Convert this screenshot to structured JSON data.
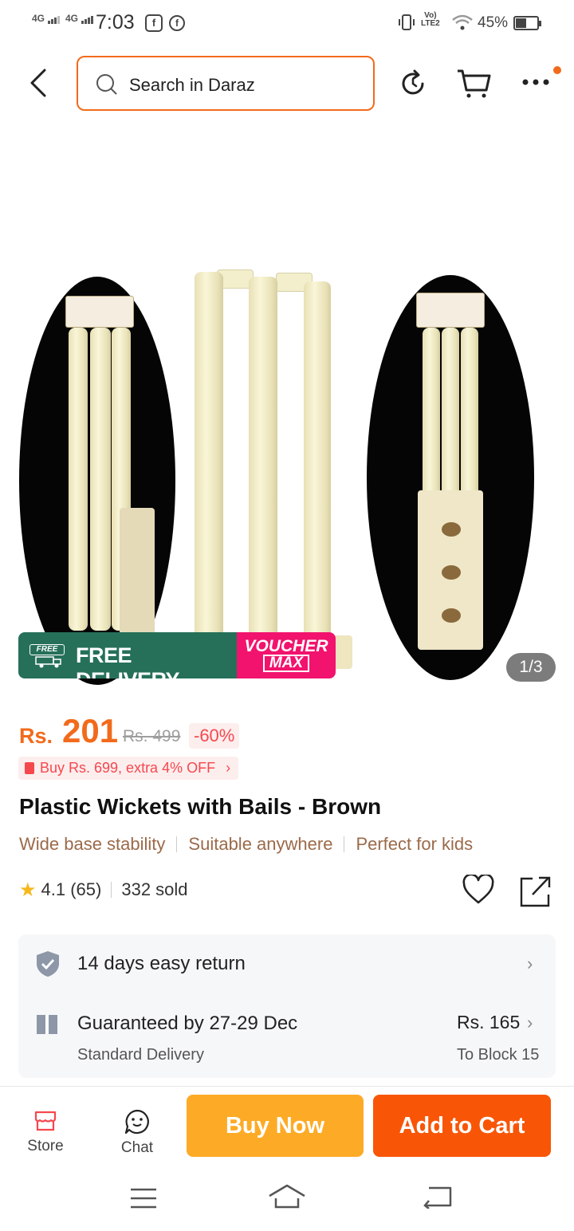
{
  "status_bar": {
    "sim1": "4G",
    "sim2": "4G",
    "time": "7:03",
    "facebook_icon": "facebook-icon",
    "volte": "Vo) LTE2",
    "battery_pct": "45%"
  },
  "header": {
    "search_placeholder": "Search in Daraz",
    "icons": [
      "back-arrow-icon",
      "history-icon",
      "cart-icon",
      "more-icon"
    ]
  },
  "gallery": {
    "image_desc_icon": "cricket-wickets-image",
    "counter": "1/3",
    "banner": {
      "free_chip": "FREE",
      "free_delivery": "FREE DELIVERY",
      "voucher": "VOUCHER",
      "max": "MAX"
    }
  },
  "price": {
    "currency": "Rs.",
    "current": "201",
    "original": "Rs. 499",
    "discount": "-60%",
    "promo": "Buy Rs. 699, extra 4% OFF"
  },
  "product": {
    "title": "Plastic Wickets with Bails - Brown",
    "features": [
      "Wide base stability",
      "Suitable anywhere",
      "Perfect for kids"
    ],
    "rating": "4.1 (65)",
    "sold": "332 sold"
  },
  "info": {
    "return": "14 days easy return",
    "delivery": "Guaranteed by 27-29 Dec",
    "delivery_type": "Standard Delivery",
    "delivery_fee": "Rs. 165",
    "delivery_to": "To Block 15"
  },
  "bottom_bar": {
    "store": "Store",
    "chat": "Chat",
    "buy_now": "Buy Now",
    "add_to_cart": "Add to Cart"
  },
  "colors": {
    "accent": "#f26a1b",
    "buy_now": "#fdab26",
    "add_to_cart": "#f85606",
    "feature_text": "#9b6a4a",
    "free_delivery_bg": "#26705a",
    "voucher_bg": "#f2136e"
  }
}
